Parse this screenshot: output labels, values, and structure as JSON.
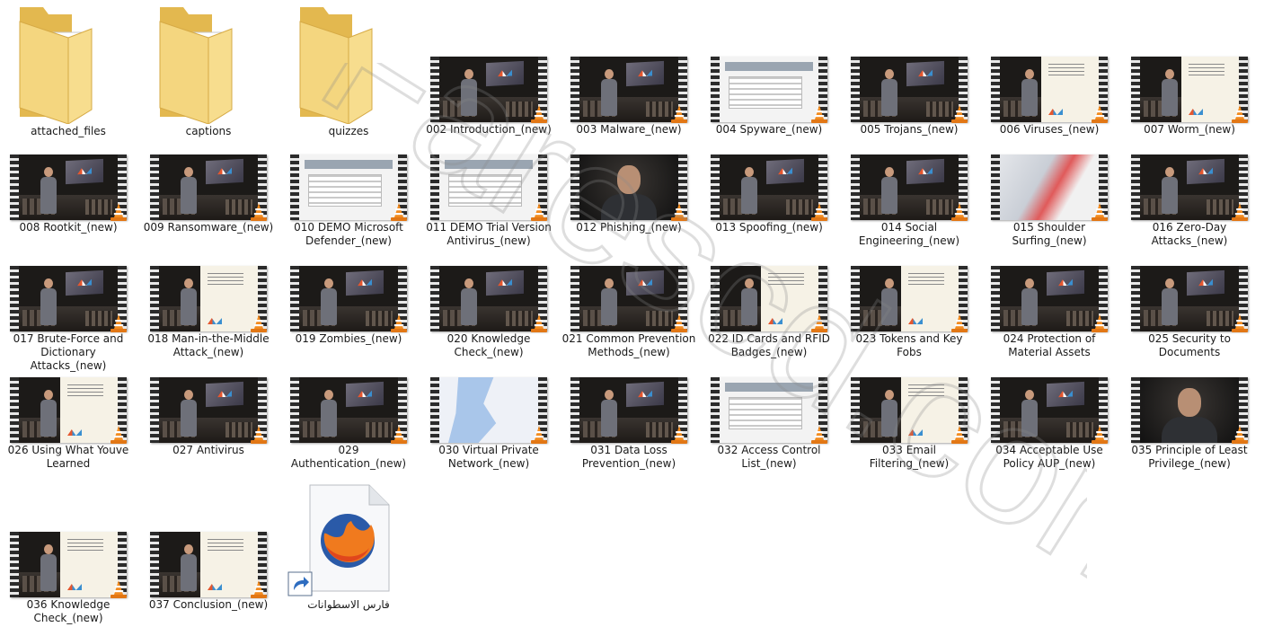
{
  "folders": [
    {
      "name": "attached_files"
    },
    {
      "name": "captions"
    },
    {
      "name": "quizzes"
    }
  ],
  "videos": [
    {
      "name": "002 Introduction_(new)",
      "thumb": "presenter-screen"
    },
    {
      "name": "003 Malware_(new)",
      "thumb": "presenter-screen"
    },
    {
      "name": "004 Spyware_(new)",
      "thumb": "ui-screenshot"
    },
    {
      "name": "005 Trojans_(new)",
      "thumb": "presenter-screen"
    },
    {
      "name": "006 Viruses_(new)",
      "thumb": "presenter-slide"
    },
    {
      "name": "007 Worm_(new)",
      "thumb": "presenter-slide"
    },
    {
      "name": "008 Rootkit_(new)",
      "thumb": "presenter-screen"
    },
    {
      "name": "009 Ransomware_(new)",
      "thumb": "presenter-screen"
    },
    {
      "name": "010 DEMO Microsoft Defender_(new)",
      "thumb": "ui-screenshot"
    },
    {
      "name": "011 DEMO Trial Version Antivirus_(new)",
      "thumb": "ui-screenshot"
    },
    {
      "name": "012 Phishing_(new)",
      "thumb": "closeup"
    },
    {
      "name": "013 Spoofing_(new)",
      "thumb": "presenter-screen"
    },
    {
      "name": "014 Social Engineering_(new)",
      "thumb": "presenter-screen"
    },
    {
      "name": "015 Shoulder Surfing_(new)",
      "thumb": "blur"
    },
    {
      "name": "016 Zero-Day Attacks_(new)",
      "thumb": "presenter-screen"
    },
    {
      "name": "017 Brute-Force and Dictionary Attacks_(new)",
      "thumb": "presenter-screen"
    },
    {
      "name": "018 Man-in-the-Middle Attack_(new)",
      "thumb": "presenter-slide"
    },
    {
      "name": "019 Zombies_(new)",
      "thumb": "presenter-screen"
    },
    {
      "name": "020 Knowledge Check_(new)",
      "thumb": "presenter-screen"
    },
    {
      "name": "021 Common Prevention Methods_(new)",
      "thumb": "presenter-screen"
    },
    {
      "name": "022 ID Cards and RFID Badges_(new)",
      "thumb": "presenter-slide"
    },
    {
      "name": "023 Tokens and Key Fobs",
      "thumb": "presenter-slide"
    },
    {
      "name": "024 Protection of Material Assets",
      "thumb": "presenter-screen"
    },
    {
      "name": "025 Security to Documents",
      "thumb": "presenter-screen"
    },
    {
      "name": "026 Using What Youve Learned",
      "thumb": "presenter-slide"
    },
    {
      "name": "027 Antivirus",
      "thumb": "presenter-screen"
    },
    {
      "name": "029 Authentication_(new)",
      "thumb": "presenter-screen"
    },
    {
      "name": "030 Virtual Private Network_(new)",
      "thumb": "map"
    },
    {
      "name": "031 Data Loss Prevention_(new)",
      "thumb": "presenter-screen"
    },
    {
      "name": "032 Access Control List_(new)",
      "thumb": "ui-screenshot"
    },
    {
      "name": "033 Email Filtering_(new)",
      "thumb": "presenter-slide"
    },
    {
      "name": "034 Acceptable Use Policy AUP_(new)",
      "thumb": "presenter-screen"
    },
    {
      "name": "035 Principle of Least Privilege_(new)",
      "thumb": "closeup"
    },
    {
      "name": "036 Knowledge Check_(new)",
      "thumb": "presenter-slide"
    },
    {
      "name": "037 Conclusion_(new)",
      "thumb": "presenter-slide"
    }
  ],
  "shortcut": {
    "name": "فارس الاسطوانات",
    "icon": "firefox-shortcut-icon"
  },
  "watermark": "Farescd.com",
  "colors": {
    "folder": "#f2d27a",
    "vlc_cone": "#f28b1f",
    "background": "#ffffff"
  }
}
